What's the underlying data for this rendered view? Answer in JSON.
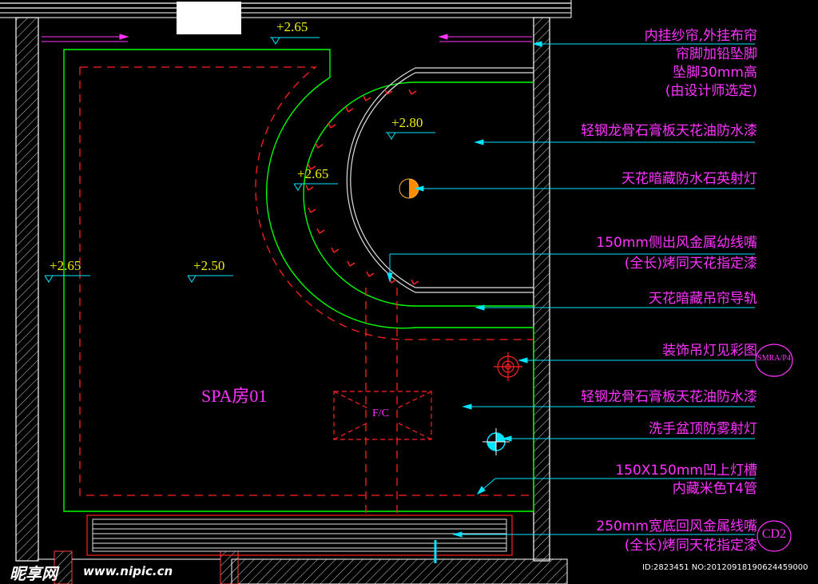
{
  "room_label": "SPA房01",
  "fc_label": "F/C",
  "levels": [
    "+2.65",
    "+2.80",
    "+2.65",
    "+2.65",
    "+2.50"
  ],
  "annotations": [
    "内挂纱帘,外挂布帘",
    "帘脚加铅坠脚",
    "坠脚30mm高",
    "(由设计师选定)",
    "轻钢龙骨石膏板天花油防水漆",
    "天花暗藏防水石英射灯",
    "150mm侧出风金属幼线嘴",
    "(全长)烤同天花指定漆",
    "天花暗藏吊帘导轨",
    "装饰吊灯见彩图",
    "轻钢龙骨石膏板天花油防水漆",
    "洗手盆顶防雾射灯",
    "150X150mm凹上灯槽",
    "内藏米色T4管",
    "250mm宽底回风金属线嘴",
    "(全长)烤同天花指定漆"
  ],
  "refs": [
    "SMRA/P4",
    "CD2"
  ],
  "watermark": {
    "brand": "昵享网",
    "url": "www.nipic.cn",
    "id": "ID:2823451 NO:20120918190624459000"
  },
  "colors": {
    "wall": "#ffffff",
    "green": "#00ff00",
    "red": "#ff2020",
    "cyan": "#00e5ff",
    "magenta": "#ff33ff",
    "orange": "#ff8c00"
  }
}
